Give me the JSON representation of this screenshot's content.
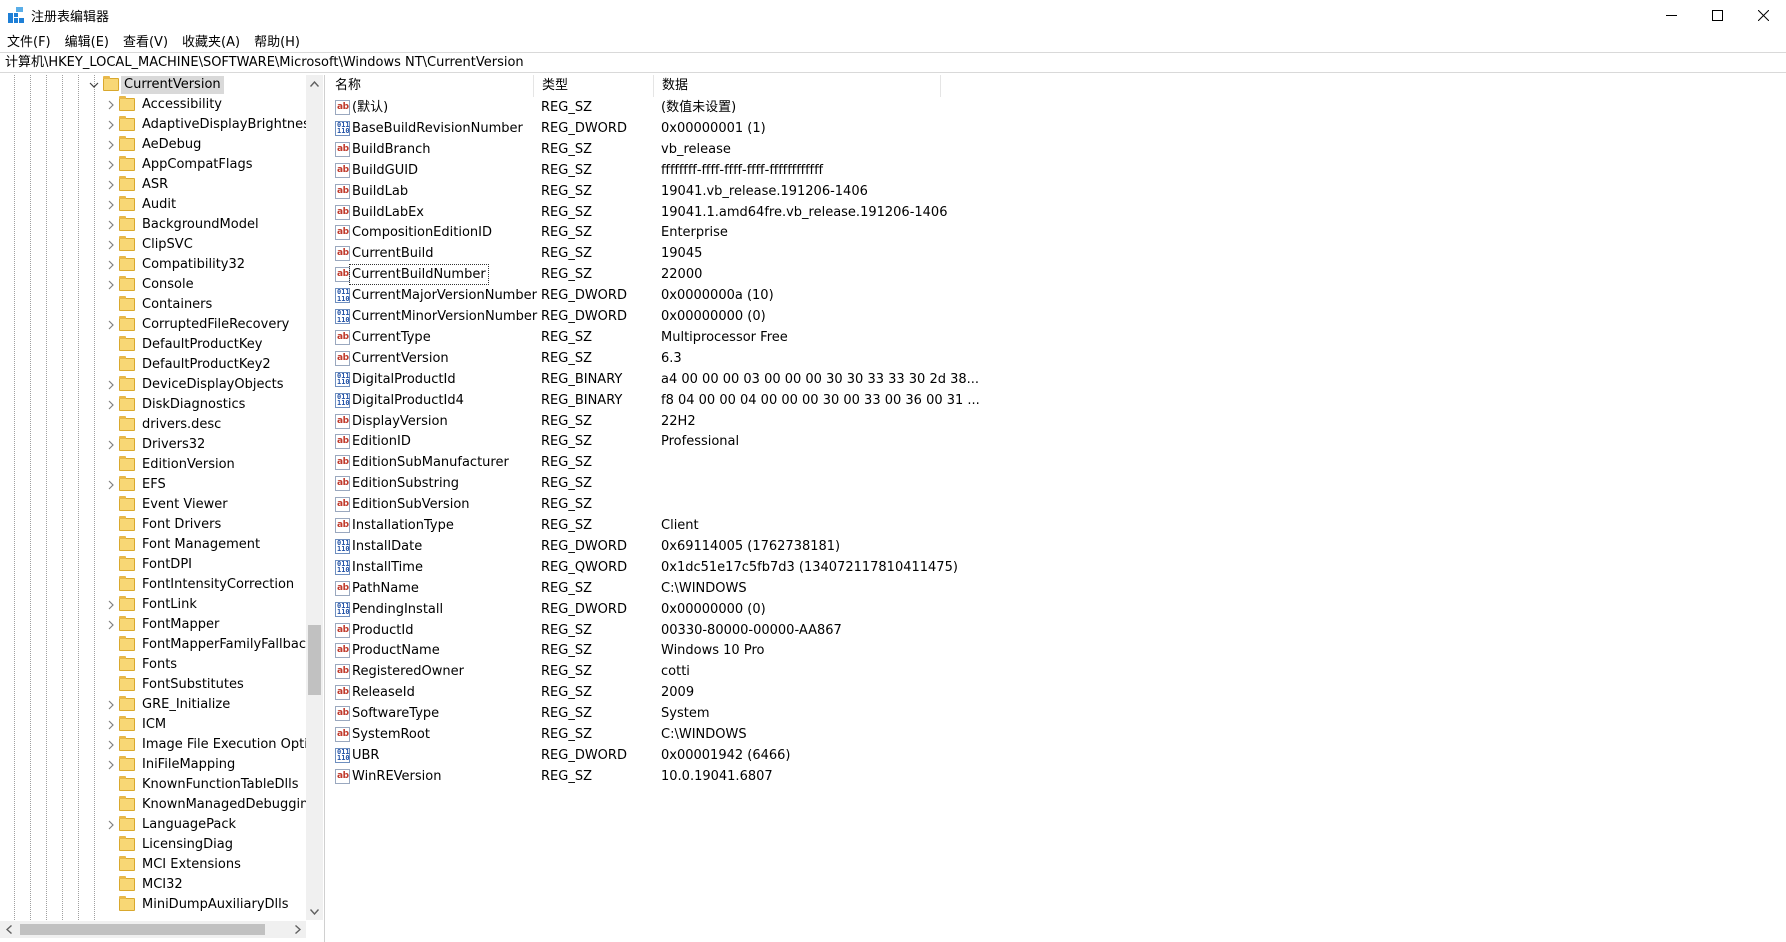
{
  "window": {
    "title": "注册表编辑器",
    "minimize_icon": "minimize-icon",
    "maximize_icon": "maximize-icon",
    "close_icon": "close-icon"
  },
  "menu": [
    "文件(F)",
    "编辑(E)",
    "查看(V)",
    "收藏夹(A)",
    "帮助(H)"
  ],
  "address": "计算机\\HKEY_LOCAL_MACHINE\\SOFTWARE\\Microsoft\\Windows NT\\CurrentVersion",
  "tree": {
    "selected": "CurrentVersion",
    "children": [
      {
        "label": "Accessibility",
        "expandable": true
      },
      {
        "label": "AdaptiveDisplayBrightness",
        "expandable": true
      },
      {
        "label": "AeDebug",
        "expandable": true
      },
      {
        "label": "AppCompatFlags",
        "expandable": true
      },
      {
        "label": "ASR",
        "expandable": true
      },
      {
        "label": "Audit",
        "expandable": true
      },
      {
        "label": "BackgroundModel",
        "expandable": true
      },
      {
        "label": "ClipSVC",
        "expandable": true
      },
      {
        "label": "Compatibility32",
        "expandable": true
      },
      {
        "label": "Console",
        "expandable": true
      },
      {
        "label": "Containers",
        "expandable": false
      },
      {
        "label": "CorruptedFileRecovery",
        "expandable": true
      },
      {
        "label": "DefaultProductKey",
        "expandable": false
      },
      {
        "label": "DefaultProductKey2",
        "expandable": false
      },
      {
        "label": "DeviceDisplayObjects",
        "expandable": true
      },
      {
        "label": "DiskDiagnostics",
        "expandable": true
      },
      {
        "label": "drivers.desc",
        "expandable": false
      },
      {
        "label": "Drivers32",
        "expandable": true
      },
      {
        "label": "EditionVersion",
        "expandable": false
      },
      {
        "label": "EFS",
        "expandable": true
      },
      {
        "label": "Event Viewer",
        "expandable": false
      },
      {
        "label": "Font Drivers",
        "expandable": false
      },
      {
        "label": "Font Management",
        "expandable": false
      },
      {
        "label": "FontDPI",
        "expandable": false
      },
      {
        "label": "FontIntensityCorrection",
        "expandable": false
      },
      {
        "label": "FontLink",
        "expandable": true
      },
      {
        "label": "FontMapper",
        "expandable": true
      },
      {
        "label": "FontMapperFamilyFallback",
        "expandable": false
      },
      {
        "label": "Fonts",
        "expandable": false
      },
      {
        "label": "FontSubstitutes",
        "expandable": false
      },
      {
        "label": "GRE_Initialize",
        "expandable": true
      },
      {
        "label": "ICM",
        "expandable": true
      },
      {
        "label": "Image File Execution Options",
        "expandable": true
      },
      {
        "label": "IniFileMapping",
        "expandable": true
      },
      {
        "label": "KnownFunctionTableDlls",
        "expandable": false
      },
      {
        "label": "KnownManagedDebuggingDlls",
        "expandable": false
      },
      {
        "label": "LanguagePack",
        "expandable": true
      },
      {
        "label": "LicensingDiag",
        "expandable": false
      },
      {
        "label": "MCI Extensions",
        "expandable": false
      },
      {
        "label": "MCI32",
        "expandable": false
      },
      {
        "label": "MiniDumpAuxiliaryDlls",
        "expandable": false
      }
    ]
  },
  "columns": {
    "name": "名称",
    "type": "类型",
    "data": "数据"
  },
  "values": [
    {
      "name": "(默认)",
      "type": "REG_SZ",
      "data": "(数值未设置)",
      "icon": "string-value-icon"
    },
    {
      "name": "BaseBuildRevisionNumber",
      "type": "REG_DWORD",
      "data": "0x00000001 (1)",
      "icon": "binary-value-icon"
    },
    {
      "name": "BuildBranch",
      "type": "REG_SZ",
      "data": "vb_release",
      "icon": "string-value-icon"
    },
    {
      "name": "BuildGUID",
      "type": "REG_SZ",
      "data": "ffffffff-ffff-ffff-ffff-ffffffffffff",
      "icon": "string-value-icon"
    },
    {
      "name": "BuildLab",
      "type": "REG_SZ",
      "data": "19041.vb_release.191206-1406",
      "icon": "string-value-icon"
    },
    {
      "name": "BuildLabEx",
      "type": "REG_SZ",
      "data": "19041.1.amd64fre.vb_release.191206-1406",
      "icon": "string-value-icon"
    },
    {
      "name": "CompositionEditionID",
      "type": "REG_SZ",
      "data": "Enterprise",
      "icon": "string-value-icon"
    },
    {
      "name": "CurrentBuild",
      "type": "REG_SZ",
      "data": "19045",
      "icon": "string-value-icon"
    },
    {
      "name": "CurrentBuildNumber",
      "type": "REG_SZ",
      "data": "22000",
      "icon": "string-value-icon",
      "focused": true
    },
    {
      "name": "CurrentMajorVersionNumber",
      "type": "REG_DWORD",
      "data": "0x0000000a (10)",
      "icon": "binary-value-icon"
    },
    {
      "name": "CurrentMinorVersionNumber",
      "type": "REG_DWORD",
      "data": "0x00000000 (0)",
      "icon": "binary-value-icon"
    },
    {
      "name": "CurrentType",
      "type": "REG_SZ",
      "data": "Multiprocessor Free",
      "icon": "string-value-icon"
    },
    {
      "name": "CurrentVersion",
      "type": "REG_SZ",
      "data": "6.3",
      "icon": "string-value-icon"
    },
    {
      "name": "DigitalProductId",
      "type": "REG_BINARY",
      "data": "a4 00 00 00 03 00 00 00 30 30 33 33 30 2d 38...",
      "icon": "binary-value-icon"
    },
    {
      "name": "DigitalProductId4",
      "type": "REG_BINARY",
      "data": "f8 04 00 00 04 00 00 00 30 00 33 00 36 00 31 ...",
      "icon": "binary-value-icon"
    },
    {
      "name": "DisplayVersion",
      "type": "REG_SZ",
      "data": "22H2",
      "icon": "string-value-icon"
    },
    {
      "name": "EditionID",
      "type": "REG_SZ",
      "data": "Professional",
      "icon": "string-value-icon"
    },
    {
      "name": "EditionSubManufacturer",
      "type": "REG_SZ",
      "data": "",
      "icon": "string-value-icon"
    },
    {
      "name": "EditionSubstring",
      "type": "REG_SZ",
      "data": "",
      "icon": "string-value-icon"
    },
    {
      "name": "EditionSubVersion",
      "type": "REG_SZ",
      "data": "",
      "icon": "string-value-icon"
    },
    {
      "name": "InstallationType",
      "type": "REG_SZ",
      "data": "Client",
      "icon": "string-value-icon"
    },
    {
      "name": "InstallDate",
      "type": "REG_DWORD",
      "data": "0x69114005 (1762738181)",
      "icon": "binary-value-icon"
    },
    {
      "name": "InstallTime",
      "type": "REG_QWORD",
      "data": "0x1dc51e17c5fb7d3 (134072117810411475)",
      "icon": "binary-value-icon"
    },
    {
      "name": "PathName",
      "type": "REG_SZ",
      "data": "C:\\WINDOWS",
      "icon": "string-value-icon"
    },
    {
      "name": "PendingInstall",
      "type": "REG_DWORD",
      "data": "0x00000000 (0)",
      "icon": "binary-value-icon"
    },
    {
      "name": "ProductId",
      "type": "REG_SZ",
      "data": "00330-80000-00000-AA867",
      "icon": "string-value-icon"
    },
    {
      "name": "ProductName",
      "type": "REG_SZ",
      "data": "Windows 10 Pro",
      "icon": "string-value-icon"
    },
    {
      "name": "RegisteredOwner",
      "type": "REG_SZ",
      "data": "cotti",
      "icon": "string-value-icon"
    },
    {
      "name": "ReleaseId",
      "type": "REG_SZ",
      "data": "2009",
      "icon": "string-value-icon"
    },
    {
      "name": "SoftwareType",
      "type": "REG_SZ",
      "data": "System",
      "icon": "string-value-icon"
    },
    {
      "name": "SystemRoot",
      "type": "REG_SZ",
      "data": "C:\\WINDOWS",
      "icon": "string-value-icon"
    },
    {
      "name": "UBR",
      "type": "REG_DWORD",
      "data": "0x00001942 (6466)",
      "icon": "binary-value-icon"
    },
    {
      "name": "WinREVersion",
      "type": "REG_SZ",
      "data": "10.0.19041.6807",
      "icon": "string-value-icon"
    }
  ],
  "colors": {
    "folder": "#f8d775",
    "selection": "#d9d9d9",
    "app_icon": "#1e7fd6"
  }
}
